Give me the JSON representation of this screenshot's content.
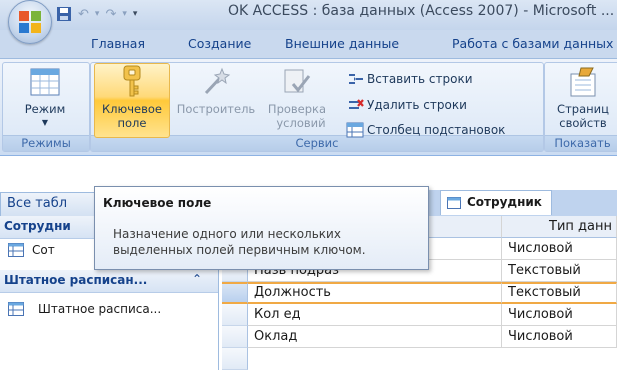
{
  "window": {
    "title": "OK ACCESS : база данных (Access 2007) - Microsoft ..."
  },
  "tabs": [
    {
      "label": "Главная"
    },
    {
      "label": "Создание"
    },
    {
      "label": "Внешние данные"
    },
    {
      "label": "Работа с базами данных"
    }
  ],
  "ribbon": {
    "view": {
      "label": "Режим",
      "group": "Режимы"
    },
    "key": {
      "label_line1": "Ключевое",
      "label_line2": "поле"
    },
    "builder": {
      "label": "Построитель"
    },
    "validate": {
      "label_line1": "Проверка",
      "label_line2": "условий"
    },
    "insert_rows": {
      "label": "Вставить строки"
    },
    "delete_rows": {
      "label": "Удалить строки"
    },
    "lookup_column": {
      "label": "Столбец подстановок"
    },
    "service_group": "Сервис",
    "property_sheet": {
      "label_line1": "Страниц",
      "label_line2": "свойств"
    },
    "show_group": "Показать"
  },
  "nav": {
    "header": "Все табл",
    "groups": [
      {
        "title": "Сотрудни",
        "item": "Сот"
      },
      {
        "title": "Штатное расписан...",
        "item": "Штатное расписа..."
      }
    ]
  },
  "tooltip": {
    "title": "Ключевое поле",
    "body_line1": "Назначение одного или нескольких",
    "body_line2": "выделенных полей первичным ключом."
  },
  "document": {
    "tab_label": "Сотрудник"
  },
  "grid": {
    "col_type_header": "Тип данн",
    "rows": [
      {
        "name": "",
        "type": "Числовой"
      },
      {
        "name": "Назв подраз",
        "type": "Текстовый"
      },
      {
        "name": "Должность",
        "type": "Текстовый"
      },
      {
        "name": "Кол ед",
        "type": "Числовой"
      },
      {
        "name": "Оклад",
        "type": "Числовой"
      }
    ]
  }
}
